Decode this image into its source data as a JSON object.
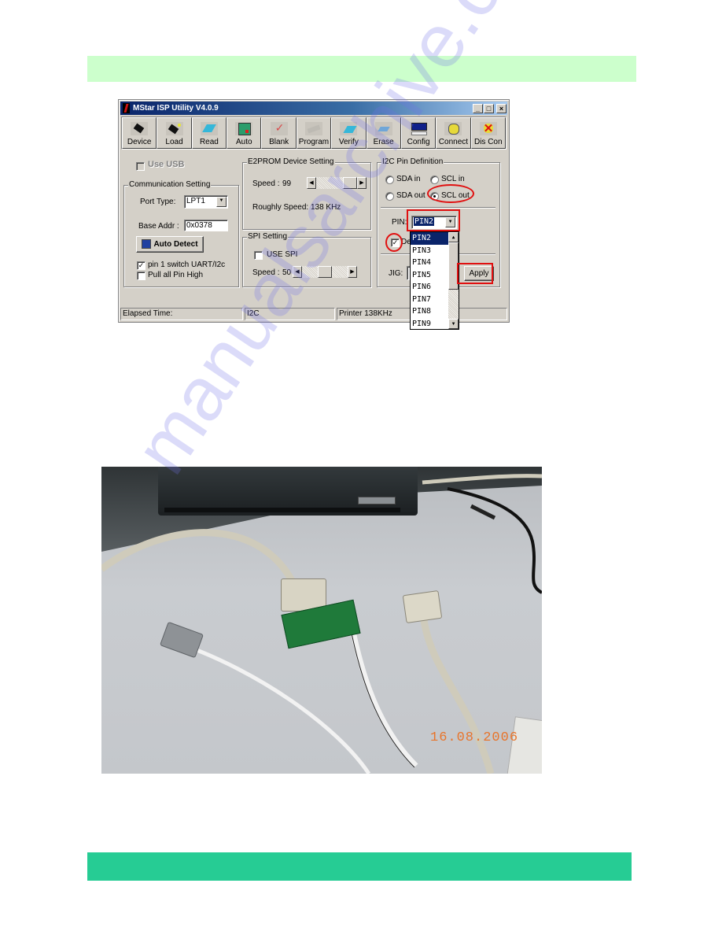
{
  "page": {
    "header_band_color": "#ccffcc",
    "footer_band_color": "#26cc94",
    "watermark": "manualsarchive.com"
  },
  "window": {
    "title": "MStar ISP Utility V4.0.9",
    "controls": {
      "minimize": "_",
      "maximize": "□",
      "close": "×"
    },
    "toolbar": [
      {
        "label": "Device",
        "icon": "chip-icon"
      },
      {
        "label": "Load",
        "icon": "chip-load-icon"
      },
      {
        "label": "Read",
        "icon": "read-icon"
      },
      {
        "label": "Auto",
        "icon": "auto-icon"
      },
      {
        "label": "Blank",
        "icon": "blank-check-icon"
      },
      {
        "label": "Program",
        "icon": "program-icon"
      },
      {
        "label": "Verify",
        "icon": "verify-icon"
      },
      {
        "label": "Erase",
        "icon": "erase-icon"
      },
      {
        "label": "Config",
        "icon": "monitor-icon"
      },
      {
        "label": "Connect",
        "icon": "connect-icon"
      },
      {
        "label": "Dis Con",
        "icon": "disconnect-icon"
      }
    ],
    "use_usb": {
      "label": "Use USB",
      "checked": false,
      "enabled": false
    },
    "communication": {
      "legend": "Communication Setting",
      "port_type_label": "Port Type:",
      "port_type_value": "LPT1",
      "base_addr_label": "Base Addr :",
      "base_addr_value": "0x0378",
      "auto_detect_label": "Auto Detect",
      "pin1_switch": {
        "label": "pin 1 switch UART/I2c",
        "checked": true
      },
      "pull_high": {
        "label": "Pull all Pin High",
        "checked": false
      }
    },
    "e2prom": {
      "legend": "E2PROM Device Setting",
      "speed_label": "Speed :",
      "speed_value": "99",
      "speed_slider_fraction": 0.85,
      "rough_speed": "Roughly Speed: 138 KHz"
    },
    "spi": {
      "legend": "SPI Setting",
      "use_spi": {
        "label": "USE SPI",
        "checked": false
      },
      "speed_label": "Speed :",
      "speed_value": "50",
      "speed_slider_fraction": 0.5
    },
    "i2c": {
      "legend": "I2C Pin Definition",
      "radios": [
        {
          "label": "SDA in",
          "selected": false
        },
        {
          "label": "SCL in",
          "selected": false
        },
        {
          "label": "SDA out",
          "selected": false
        },
        {
          "label": "SCL out",
          "selected": true
        }
      ],
      "pin_label": "PIN:",
      "pin_value": "PIN2",
      "pin_options": [
        "PIN2",
        "PIN3",
        "PIN4",
        "PIN5",
        "PIN6",
        "PIN7",
        "PIN8",
        "PIN9"
      ],
      "invert_checked": true,
      "invert_label_partial": "De",
      "jig_label": "JIG:",
      "apply_label": "Apply"
    },
    "status": {
      "elapsed": "Elapsed Time:",
      "mode": "I2C",
      "printer": "Printer  138KHz"
    }
  },
  "photo": {
    "datestamp": "16.08.2006"
  }
}
